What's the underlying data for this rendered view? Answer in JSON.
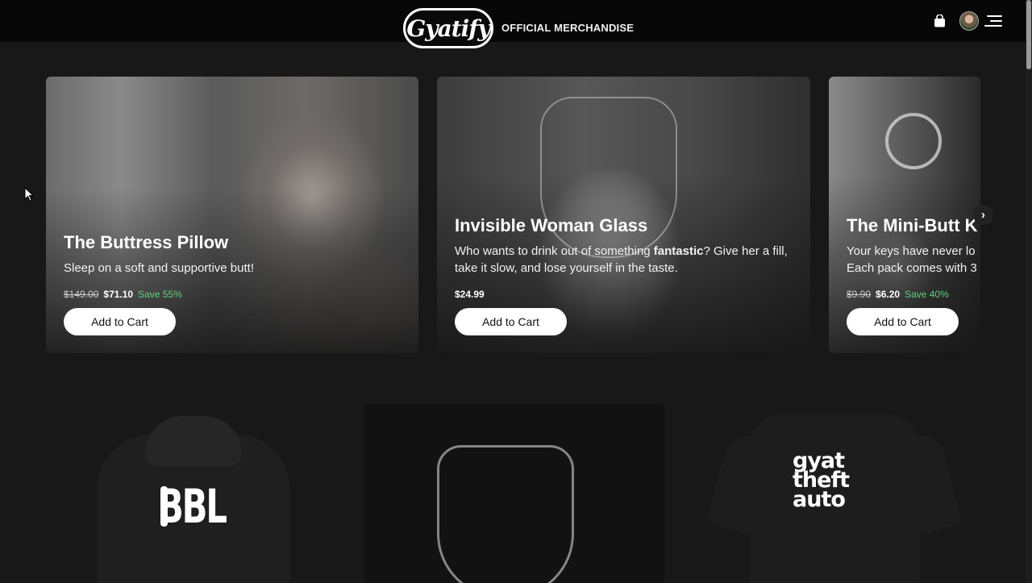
{
  "header": {
    "logo_text": "Gyatify",
    "title": "OFFICIAL MERCHANDISE",
    "icons": [
      "shopping-bag-icon",
      "avatar",
      "menu-icon"
    ]
  },
  "carousel": {
    "items": [
      {
        "title": "The Buttress Pillow",
        "description": "Sleep on a soft and supportive butt!",
        "old_price": "$149.00",
        "price": "$71.10",
        "save": "Save 55%",
        "button": "Add to Cart"
      },
      {
        "title": "Invisible Woman Glass",
        "description_before": "Who wants to drink out of something ",
        "description_bold": "fantastic",
        "description_after": "? Give her a fill, take it slow, and lose yourself in the taste.",
        "price": "$24.99",
        "button": "Add to Cart"
      },
      {
        "title": "The Mini-Butt K",
        "description": "Your keys have never lo",
        "description_line2": "Each pack comes with 3",
        "old_price": "$9.90",
        "price": "$6.20",
        "save": "Save 40%",
        "button": "Add to Cart"
      }
    ],
    "next_icon": "chevron-right-icon"
  },
  "products": {
    "hoodie_logo": "BBL",
    "tee_logo": [
      "gyat",
      "theft",
      "auto"
    ]
  },
  "colors": {
    "background": "#181818",
    "header": "#070707",
    "save_green": "#5fd27a"
  }
}
